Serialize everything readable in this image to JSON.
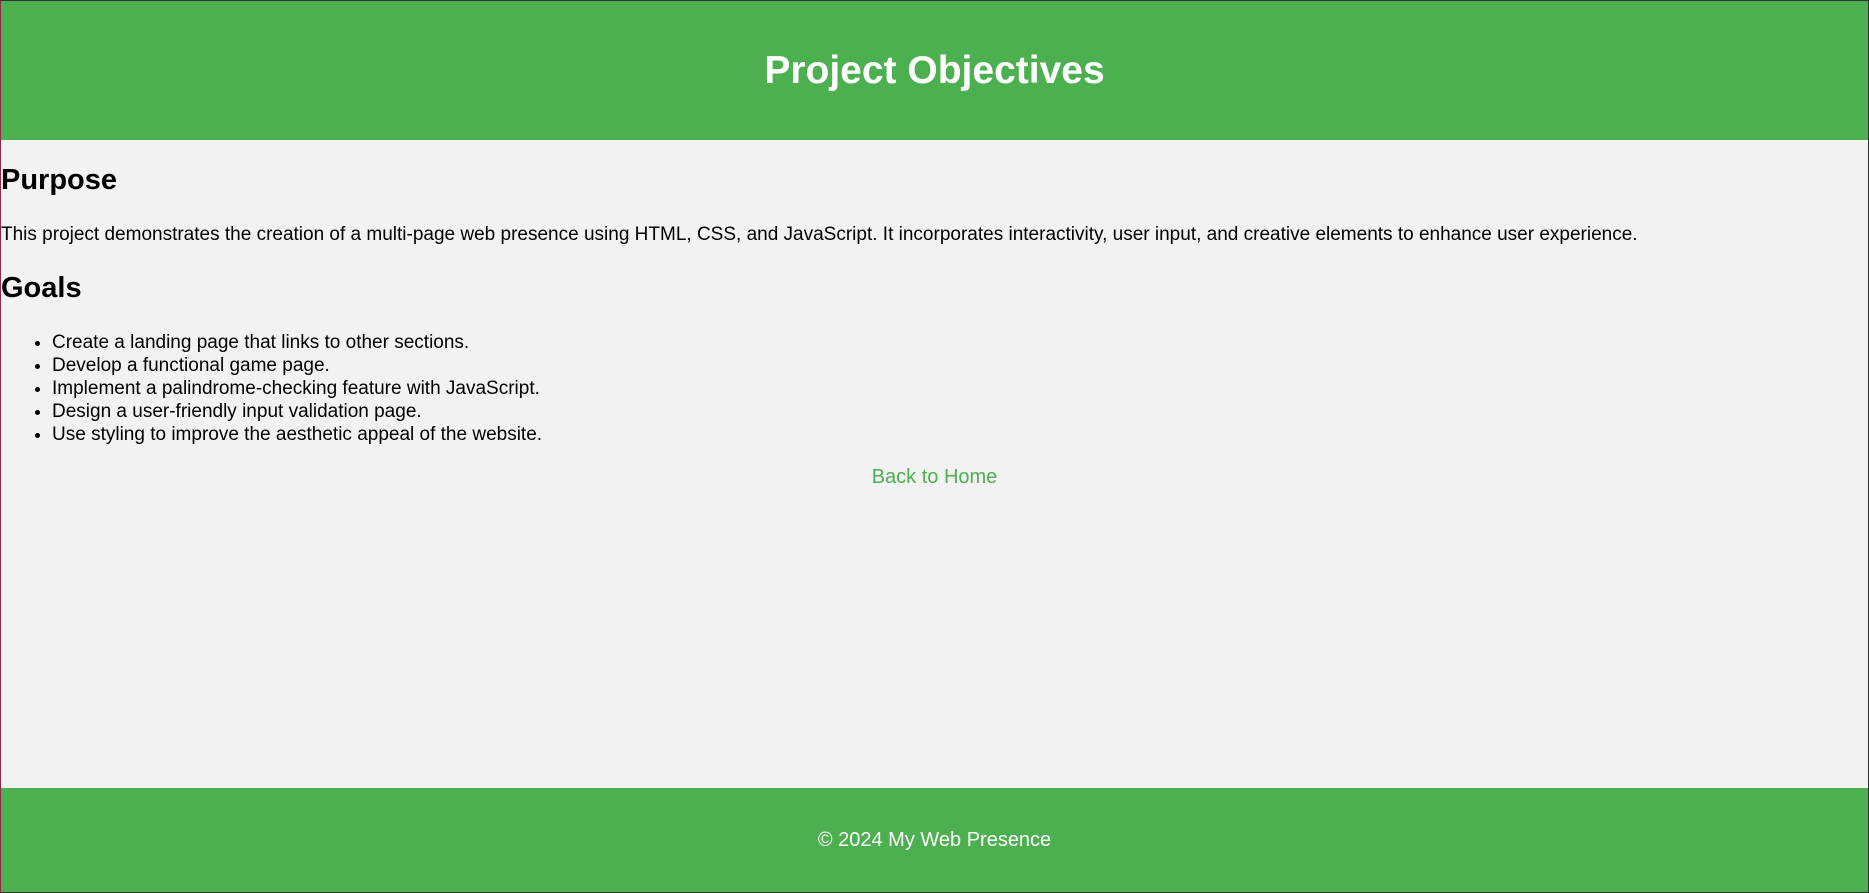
{
  "header": {
    "title": "Project Objectives"
  },
  "purpose": {
    "heading": "Purpose",
    "text": "This project demonstrates the creation of a multi-page web presence using HTML, CSS, and JavaScript. It incorporates interactivity, user input, and creative elements to enhance user experience."
  },
  "goals": {
    "heading": "Goals",
    "items": [
      "Create a landing page that links to other sections.",
      "Develop a functional game page.",
      "Implement a palindrome-checking feature with JavaScript.",
      "Design a user-friendly input validation page.",
      "Use styling to improve the aesthetic appeal of the website."
    ]
  },
  "nav": {
    "back_home_label": "Back to Home"
  },
  "footer": {
    "copyright": "© 2024 My Web Presence"
  },
  "colors": {
    "brand_green": "#4caf50",
    "background": "#f2f2f2",
    "header_text": "#ffffff"
  }
}
